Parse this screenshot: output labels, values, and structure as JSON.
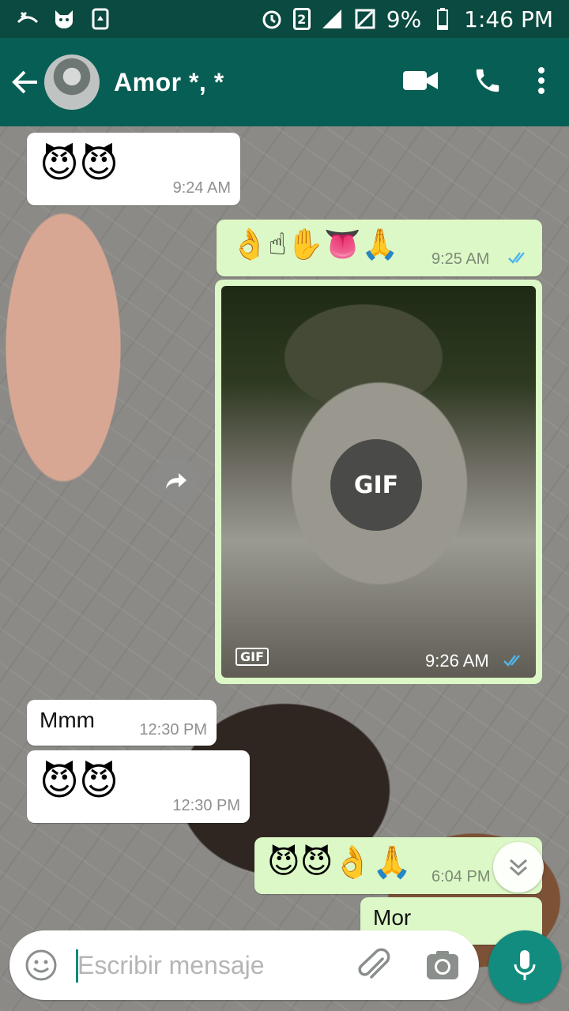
{
  "status_bar": {
    "sim_number": "2",
    "battery_percent": "9%",
    "time": "1:46 PM"
  },
  "toolbar": {
    "contact_name": "Amor *, *"
  },
  "messages": [
    {
      "emoji": "😈😈",
      "time": "9:24 AM"
    },
    {
      "emoji": "👌☝✋👅🙏",
      "time": "9:25 AM"
    },
    {
      "gif_label": "GIF",
      "time": "9:26 AM"
    },
    {
      "text": "Mmm",
      "time": "12:30 PM"
    },
    {
      "emoji": "😈😈",
      "time": "12:30 PM"
    },
    {
      "emoji": "😈😈👌🙏",
      "time": "6:04 PM"
    },
    {
      "text": "Mor"
    }
  ],
  "gif_overlay_tag": "GIF",
  "input": {
    "placeholder": "Escribir mensaje"
  }
}
